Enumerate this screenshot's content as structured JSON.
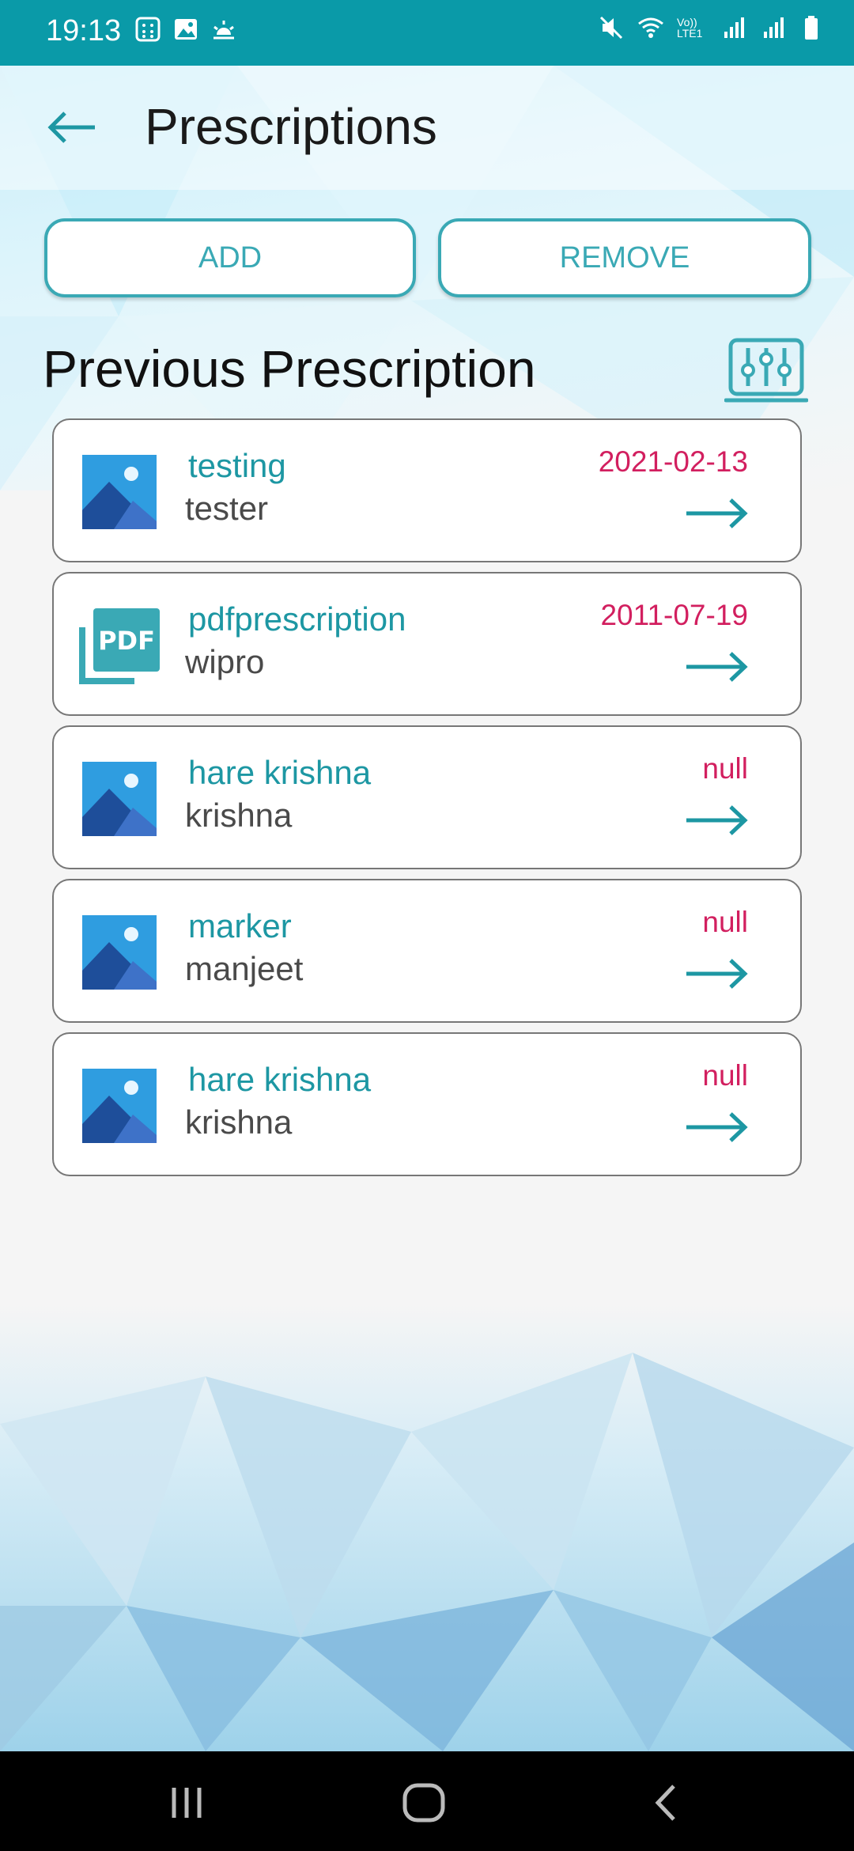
{
  "status_bar": {
    "time": "19:13",
    "left_icons": [
      "calculator-icon",
      "gallery-icon",
      "weather-sun-icon"
    ],
    "right_icons": [
      "mute-icon",
      "wifi-icon",
      "volte-icon",
      "signal-icon",
      "signal-icon",
      "battery-icon"
    ],
    "volte_label": "Vo)) LTE1"
  },
  "header": {
    "back_icon": "arrow-left-icon",
    "title": "Prescriptions"
  },
  "actions": {
    "add_label": "ADD",
    "remove_label": "REMOVE"
  },
  "section": {
    "title": "Previous Prescription",
    "filter_icon": "sliders-icon"
  },
  "prescriptions": [
    {
      "title": "testing",
      "subtitle": "tester",
      "date": "2021-02-13",
      "type": "image"
    },
    {
      "title": "pdfprescription",
      "subtitle": "wipro",
      "date": "2011-07-19",
      "type": "pdf"
    },
    {
      "title": "hare krishna",
      "subtitle": "krishna",
      "date": "null",
      "type": "image"
    },
    {
      "title": "marker",
      "subtitle": "manjeet",
      "date": "null",
      "type": "image"
    },
    {
      "title": "hare krishna",
      "subtitle": "krishna",
      "date": "null",
      "type": "image"
    }
  ],
  "nav_bar": {
    "icons": [
      "recents-icon",
      "home-icon",
      "back-icon"
    ]
  },
  "colors": {
    "accent": "#1d97a3",
    "status_bar": "#0a9aa8",
    "date": "#d21f5f"
  }
}
